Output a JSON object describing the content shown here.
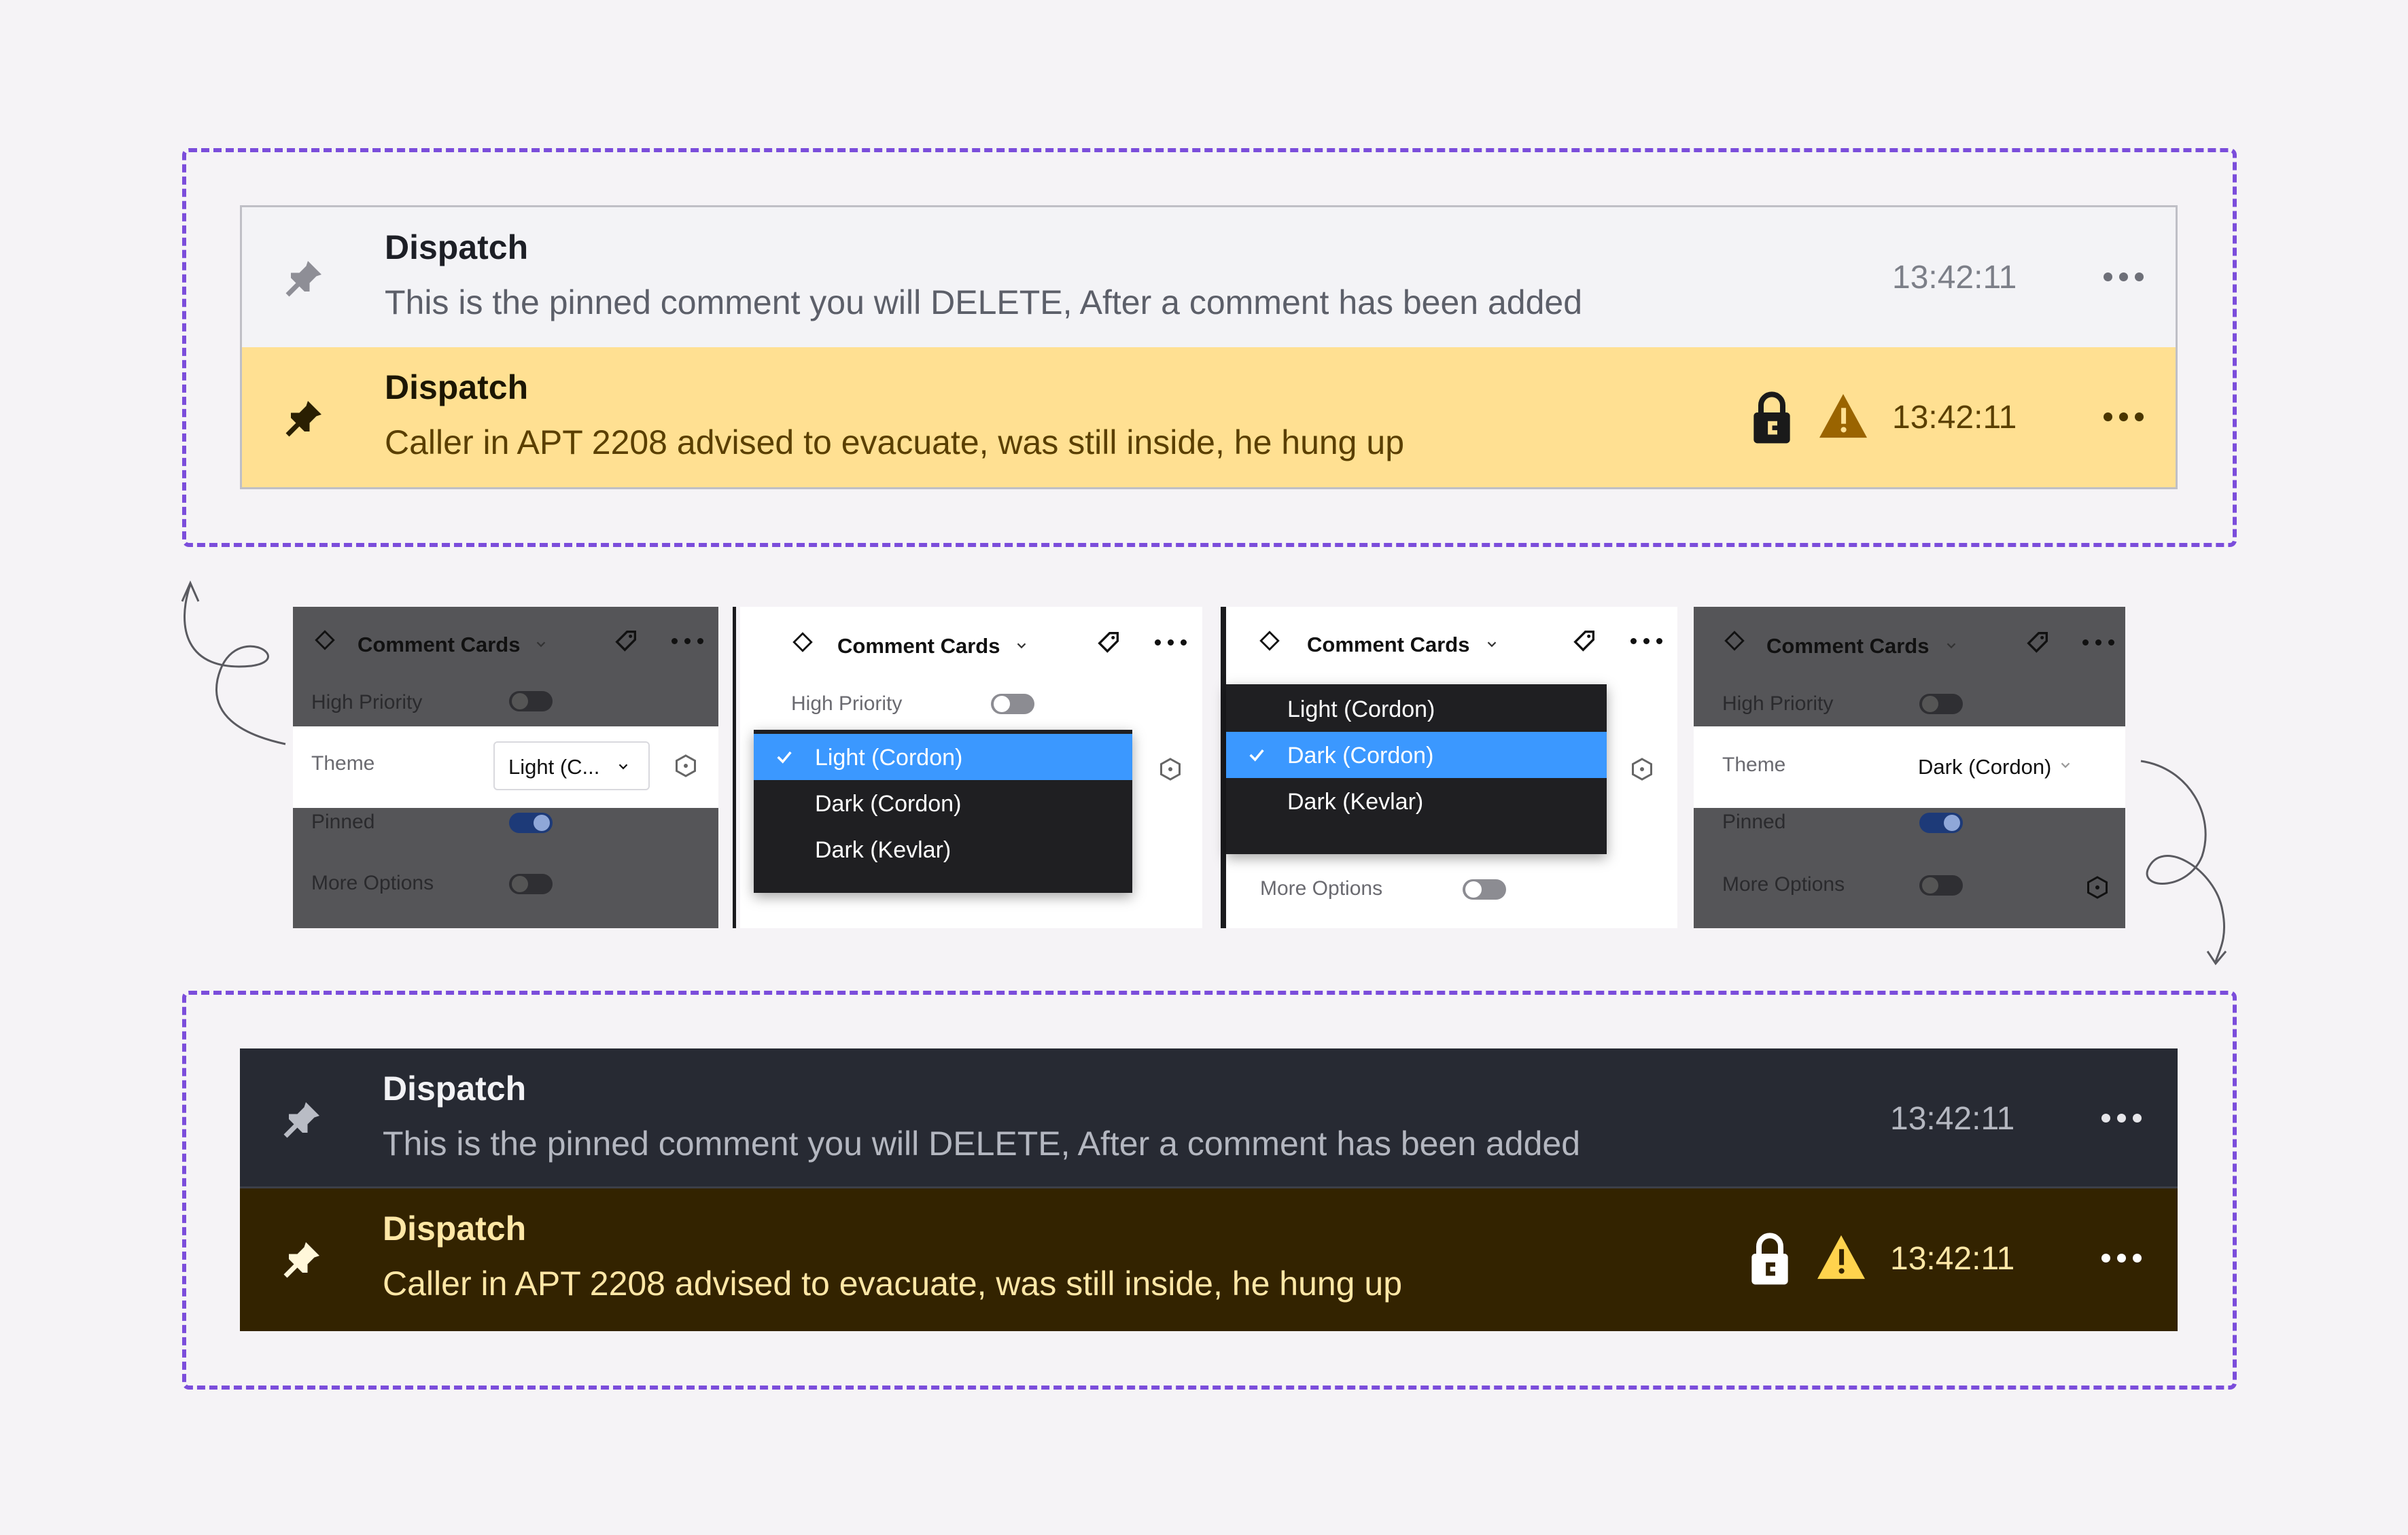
{
  "colors": {
    "accent_dash": "#7B4DDB",
    "light_normal_bg": "#F3F3F6",
    "light_pinned_bg": "#FFE092",
    "dark_normal_bg": "#272A33",
    "dark_pinned_bg": "#332300",
    "menu_highlight": "#3B98FF",
    "menu_bg": "#1F1F22"
  },
  "light_cards": [
    {
      "author": "Dispatch",
      "message": "This is the pinned comment you will DELETE, After a comment has been added",
      "time": "13:42:11",
      "icons": [
        "pin-icon",
        "more-icon"
      ]
    },
    {
      "author": "Dispatch",
      "message": "Caller in APT 2208 advised to evacuate, was still inside, he hung up",
      "time": "13:42:11",
      "icons": [
        "pin-icon",
        "lock-icon",
        "warning-icon",
        "more-icon"
      ]
    }
  ],
  "dark_cards": [
    {
      "author": "Dispatch",
      "message": "This is the pinned comment you will DELETE, After a comment has been added",
      "time": "13:42:11",
      "icons": [
        "pin-icon",
        "more-icon"
      ]
    },
    {
      "author": "Dispatch",
      "message": "Caller in APT 2208 advised to evacuate, was still inside, he hung up",
      "time": "13:42:11",
      "icons": [
        "pin-icon",
        "lock-icon",
        "warning-icon",
        "more-icon"
      ]
    }
  ],
  "panels": [
    {
      "title": "Comment Cards",
      "rows": {
        "high_priority": "High Priority",
        "theme": "Theme",
        "pinned": "Pinned",
        "more_options": "More Options"
      },
      "theme_value": "Light (C...",
      "toggles": {
        "high_priority": false,
        "pinned": true,
        "more_options": false
      }
    },
    {
      "title": "Comment Cards",
      "rows": {
        "high_priority": "High Priority"
      },
      "toggles": {
        "high_priority": false
      },
      "menu": {
        "options": [
          "Light (Cordon)",
          "Dark (Cordon)",
          "Dark (Kevlar)"
        ],
        "selected": "Light (Cordon)"
      }
    },
    {
      "title": "Comment Cards",
      "rows": {
        "more_options": "More Options"
      },
      "toggles": {
        "more_options": false
      },
      "menu": {
        "options": [
          "Light (Cordon)",
          "Dark (Cordon)",
          "Dark (Kevlar)"
        ],
        "selected": "Dark (Cordon)"
      }
    },
    {
      "title": "Comment Cards",
      "rows": {
        "high_priority": "High Priority",
        "theme": "Theme",
        "pinned": "Pinned",
        "more_options": "More Options"
      },
      "theme_value": "Dark (Cordon)",
      "toggles": {
        "high_priority": false,
        "pinned": true,
        "more_options": false
      }
    }
  ]
}
